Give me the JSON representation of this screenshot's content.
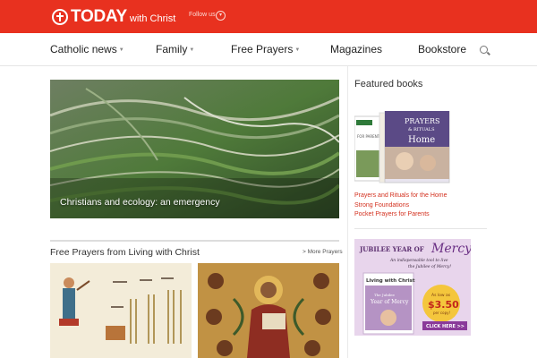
{
  "header": {
    "logo_main": "TODAY",
    "logo_sub": "with Christ",
    "follow_label": "Follow us",
    "brand_color": "#e8311f"
  },
  "nav": {
    "items": [
      {
        "label": "Catholic news",
        "has_dropdown": true
      },
      {
        "label": "Family",
        "has_dropdown": true
      },
      {
        "label": "Free Prayers",
        "has_dropdown": true
      },
      {
        "label": "Magazines",
        "has_dropdown": false
      },
      {
        "label": "Bookstore",
        "has_dropdown": false
      }
    ],
    "search_icon": "search-icon"
  },
  "main": {
    "hero_caption": "Christians and ecology: an emergency",
    "section_title": "Free Prayers from Living with Christ",
    "more_link": "More Prayers"
  },
  "sidebar": {
    "title": "Featured books",
    "book_cover_text": "PRAYERS & RITUALS for the Home",
    "book_cover_small": "FOR PARENTS",
    "links": [
      "Prayers and Rituals for the Home",
      "Strong Foundations",
      "Pocket Prayers for Parents"
    ],
    "link_color": "#d3301e",
    "ad": {
      "headline": "JUBILEE YEAR OF",
      "headline_accent": "Mercy",
      "tagline": "An indispensable tool to live the Jubilee of Mercy!",
      "magazine": "Living with Christ",
      "magazine_sub": "The Jubilee Year of Mercy",
      "price_label": "As low as",
      "price": "$3.50",
      "price_unit": "per copy!",
      "cta": "CLICK HERE >>"
    }
  }
}
